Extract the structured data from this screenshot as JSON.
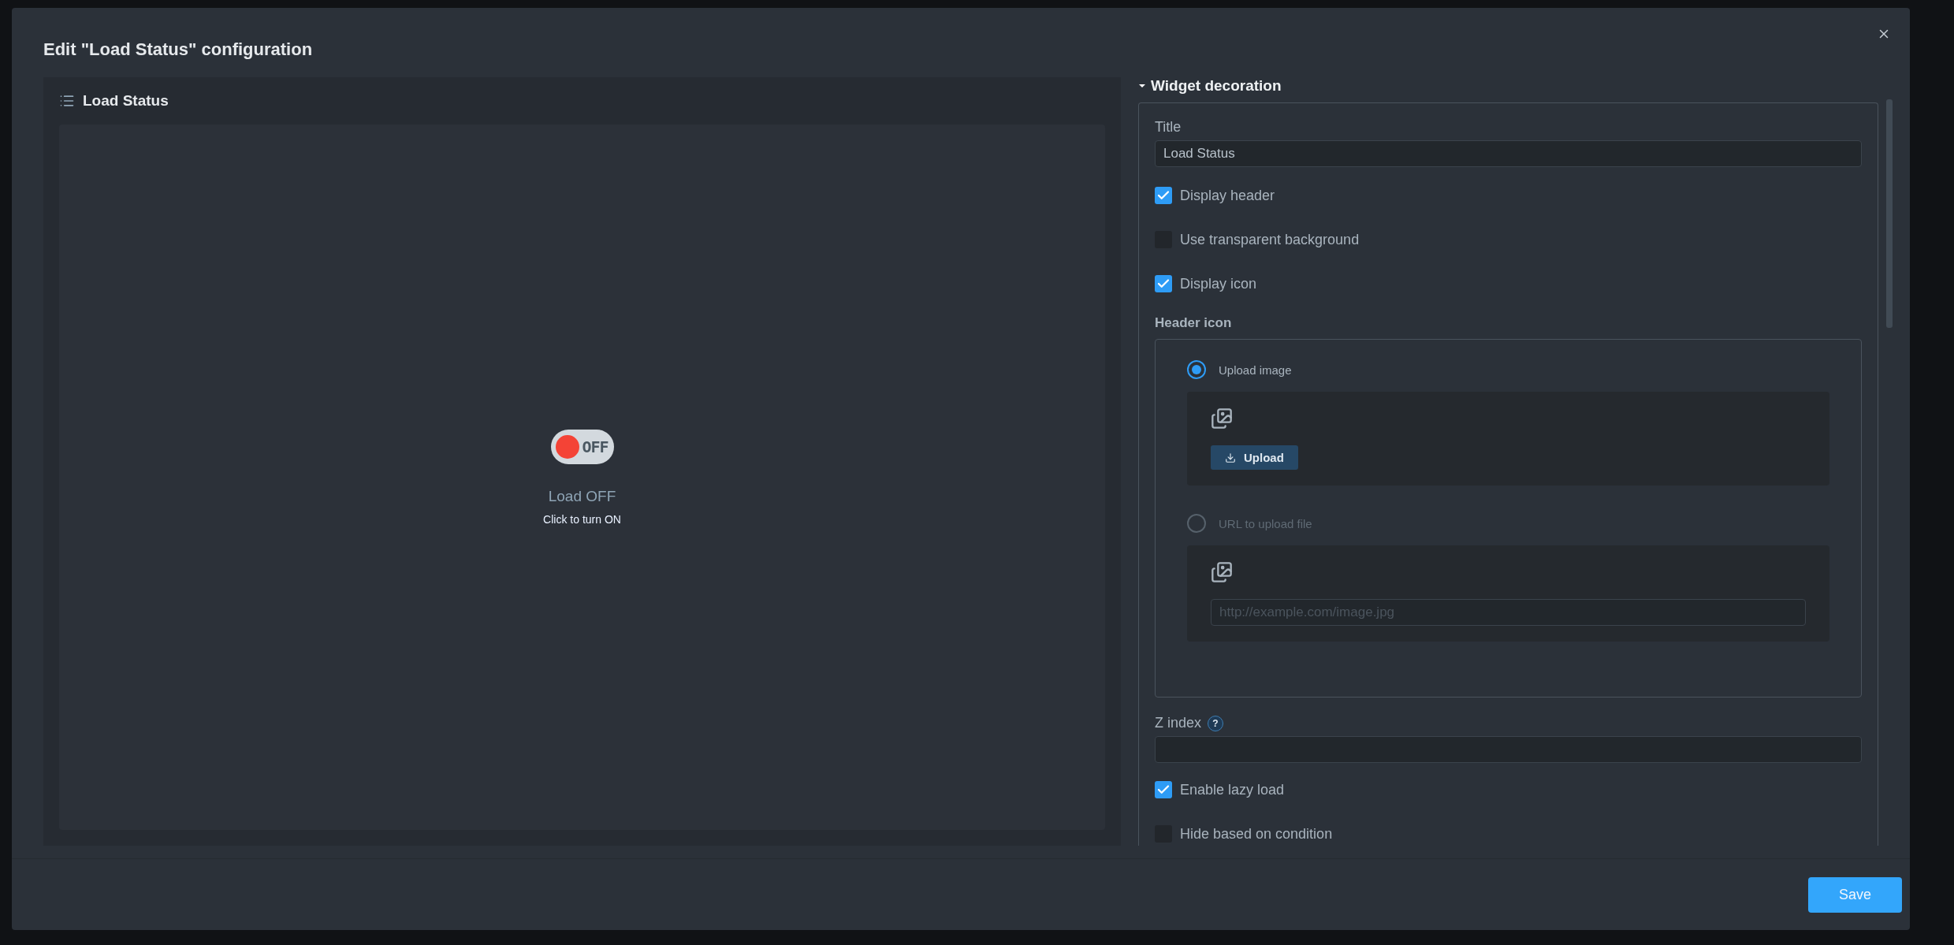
{
  "dialog": {
    "title": "Edit \"Load Status\" configuration"
  },
  "preview": {
    "header_title": "Load Status",
    "switch": {
      "on": false,
      "label": "OFF"
    },
    "status": "Load OFF",
    "hint": "Click to turn ON"
  },
  "settings": {
    "section": {
      "title": "Widget decoration",
      "expanded": true
    },
    "title_field": {
      "label": "Title",
      "value": "Load Status"
    },
    "options": [
      {
        "label": "Display header",
        "checked": true
      },
      {
        "label": "Use transparent background",
        "checked": false
      },
      {
        "label": "Display icon",
        "checked": true
      }
    ],
    "header_icon": {
      "label": "Header icon",
      "sources": [
        {
          "kind": "upload",
          "label": "Upload image",
          "selected": true,
          "button": "Upload"
        },
        {
          "kind": "url",
          "label": "URL to upload file",
          "selected": false,
          "placeholder": "http://example.com/image.jpg"
        }
      ]
    },
    "z_index": {
      "label": "Z index",
      "help": "?"
    },
    "more_options": [
      {
        "label": "Enable lazy load",
        "checked": true
      },
      {
        "label": "Hide based on condition",
        "checked": false
      }
    ]
  },
  "footer": {
    "save": "Save"
  }
}
